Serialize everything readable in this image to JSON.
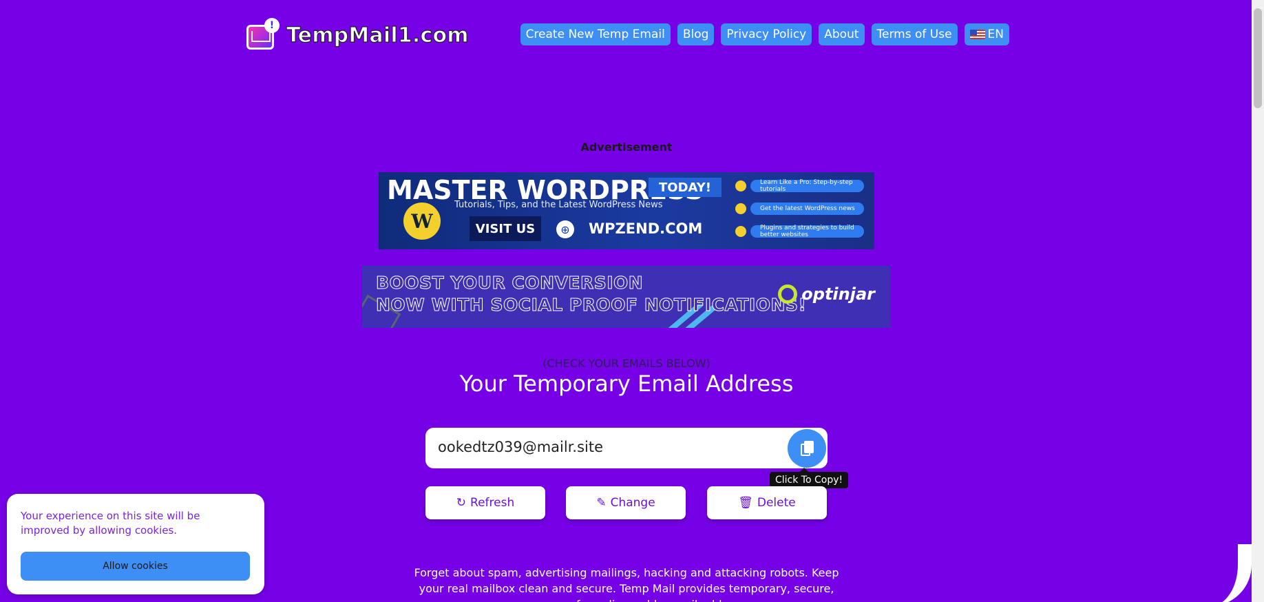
{
  "header": {
    "logo_text": "TempMail1.com",
    "nav": [
      {
        "label": "Create New Temp Email"
      },
      {
        "label": "Blog"
      },
      {
        "label": "Privacy Policy"
      },
      {
        "label": "About"
      },
      {
        "label": "Terms of Use"
      }
    ],
    "lang_label": "EN"
  },
  "ads": {
    "label": "Advertisement",
    "wordpress": {
      "headline": "MASTER WORDPRESS",
      "today": "TODAY!",
      "subline": "Tutorials, Tips, and the Latest WordPress News",
      "visit": "VISIT US",
      "site": "WPZEND.COM",
      "pills": [
        "Learn Like a Pro: Step-by-step tutorials",
        "Get the latest WordPress news",
        "Plugins and strategies to build better websites"
      ]
    },
    "optinjar": {
      "line1": "BOOST YOUR CONVERSION",
      "line2": "NOW WITH SOCIAL PROOF NOTIFICATIONS!",
      "brand": "optinjar"
    }
  },
  "email": {
    "check_label": "(CHECK YOUR EMAILS BELOW)",
    "title": "Your Temporary Email Address",
    "address": "ookedtz039@mailr.site",
    "tooltip": "Click To Copy!",
    "refresh_label": "Refresh",
    "change_label": "Change",
    "delete_label": "Delete"
  },
  "description": "Forget about spam, advertising mailings, hacking and attacking robots. Keep your real mailbox clean and secure. Temp Mail provides temporary, secure, anonymous, free, disposable email address.",
  "cookie": {
    "message": "Your experience on this site will be improved by allowing cookies.",
    "button": "Allow cookies"
  }
}
